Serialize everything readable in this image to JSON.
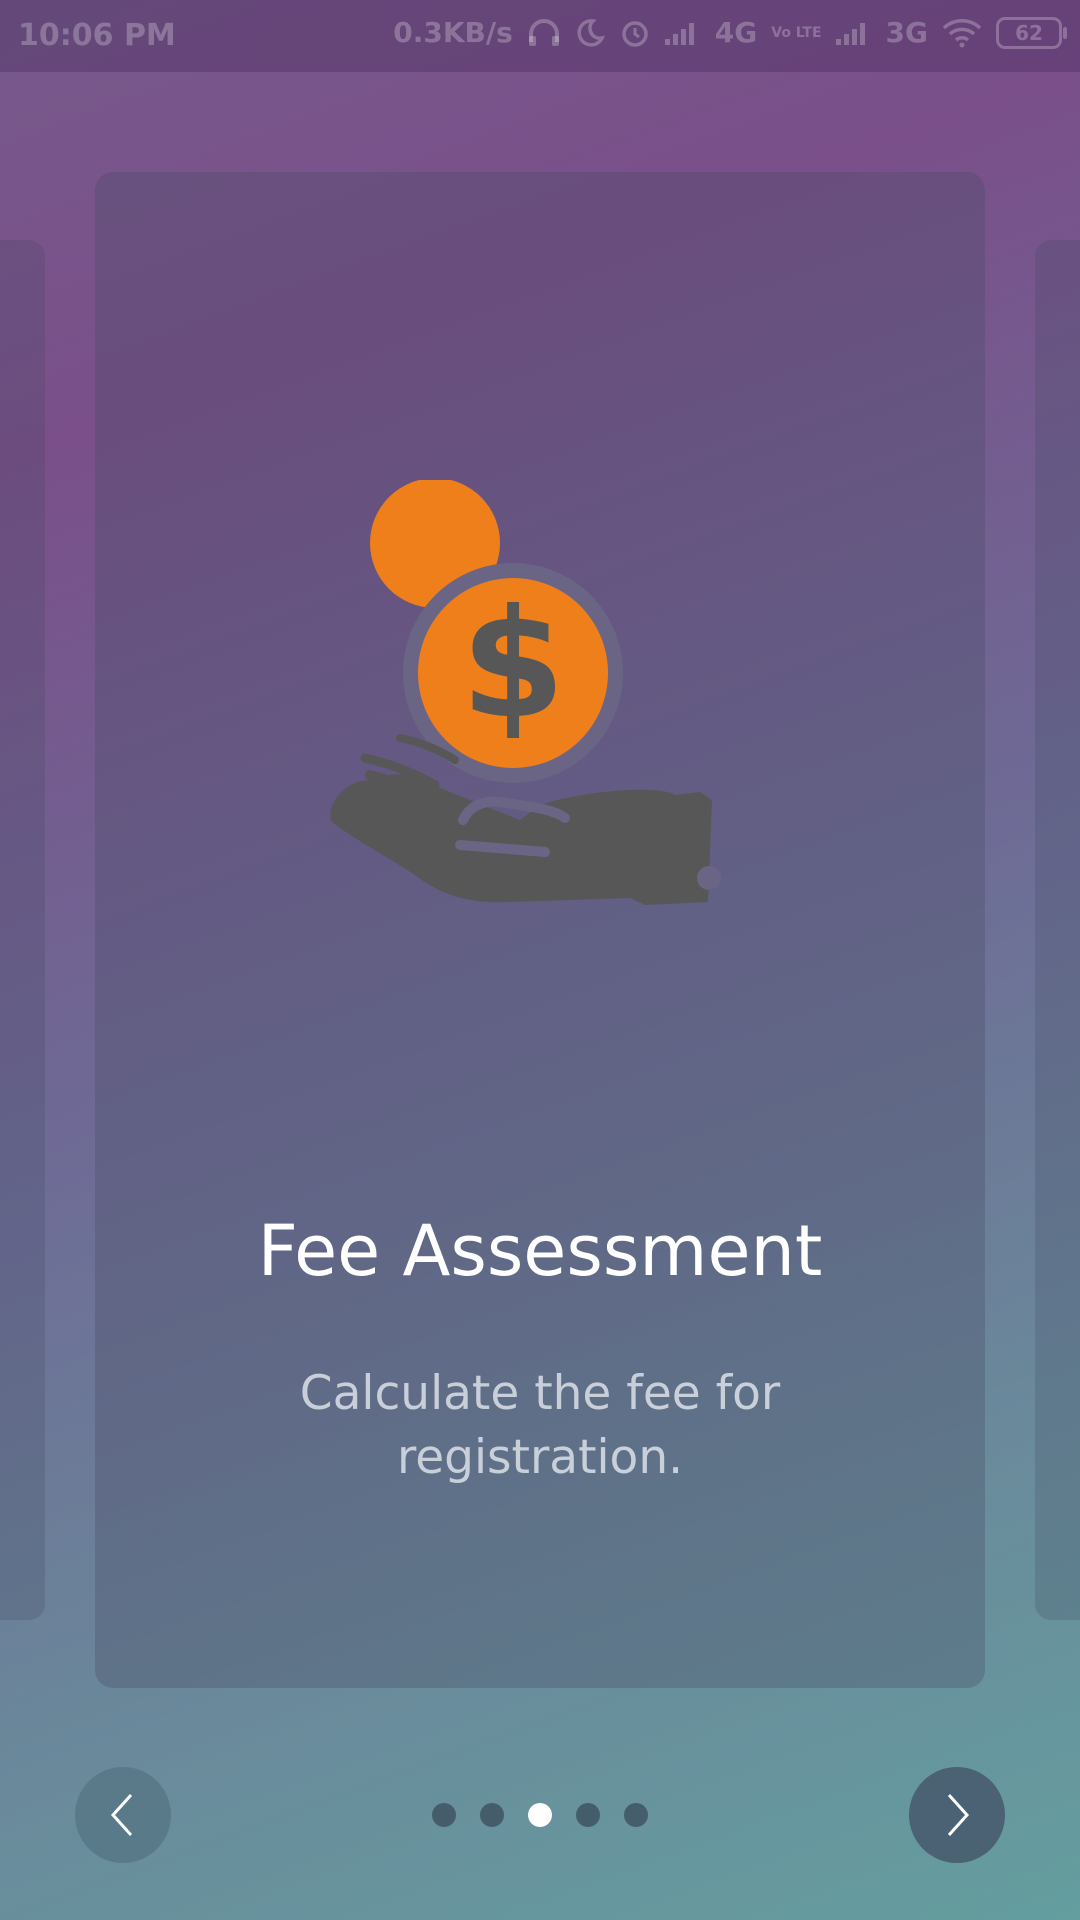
{
  "status_bar": {
    "time": "10:06 PM",
    "network_speed": "0.3KB/s",
    "network1": "4G",
    "volte": "Vo LTE",
    "network2": "3G",
    "battery": "62",
    "icons": [
      "headphones-icon",
      "moon-icon",
      "alarm-icon",
      "signal-icon",
      "signal-icon",
      "wifi-icon",
      "battery-icon"
    ]
  },
  "slide": {
    "title": "Fee Assessment",
    "description": "Calculate the fee for registration.",
    "illustration": "hand-with-coins-icon"
  },
  "pager": {
    "total": 5,
    "active_index": 2
  },
  "nav": {
    "prev_icon": "chevron-left-icon",
    "next_icon": "chevron-right-icon"
  },
  "colors": {
    "coin": "#ef7f1a",
    "hand": "#575757",
    "title": "#ffffff",
    "dot_active": "#ffffff"
  }
}
